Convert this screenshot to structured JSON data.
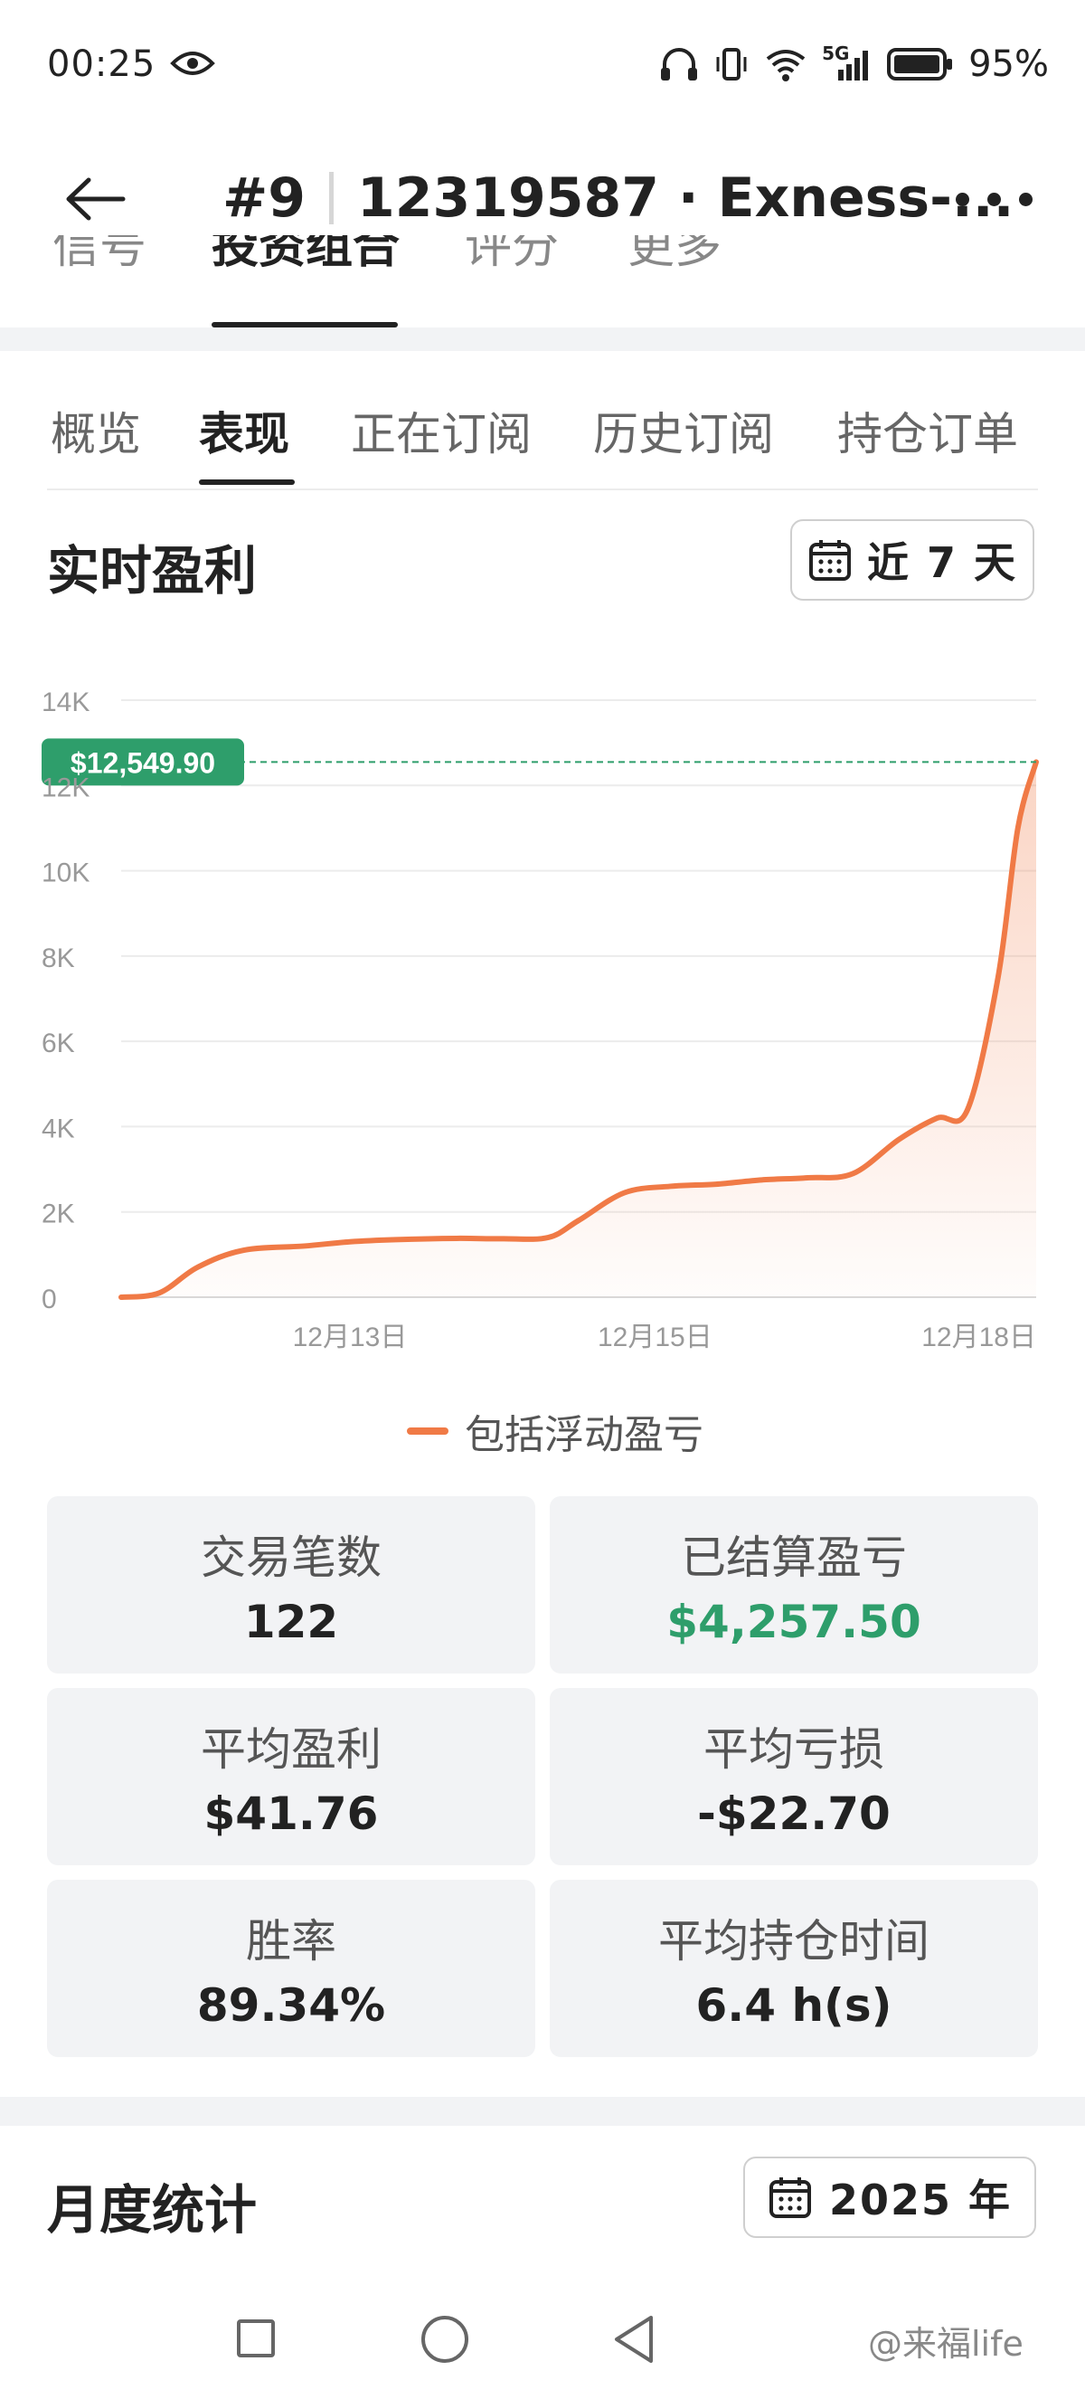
{
  "status_bar": {
    "time": "00:25",
    "network": "5G",
    "battery": "95%"
  },
  "header": {
    "rank": "#9",
    "account": "12319587 · Exness-...",
    "back_icon": "arrow-left-icon",
    "more_icon": "more-dots-icon"
  },
  "upper_tabs": [
    "信号",
    "投资组合",
    "评分",
    "更多"
  ],
  "tabs": [
    "概览",
    "表现",
    "正在订阅",
    "历史订阅",
    "持仓订单"
  ],
  "active_tab": "表现",
  "realtime": {
    "title": "实时盈利",
    "range_label": "近 7 天",
    "range_icon": "calendar-icon"
  },
  "chart_data": {
    "type": "area",
    "title": "",
    "xlabel": "",
    "ylabel": "",
    "ylim": [
      0,
      14000
    ],
    "yticks": [
      0,
      2000,
      4000,
      6000,
      8000,
      10000,
      12000,
      14000
    ],
    "ytick_labels": [
      "0",
      "2K",
      "4K",
      "6K",
      "8K",
      "10K",
      "12K",
      "14K"
    ],
    "xtick_labels": [
      "12月13日",
      "12月15日",
      "12月18日"
    ],
    "xticks": [
      1.5,
      3.5,
      6.0
    ],
    "xlim": [
      0,
      6.0
    ],
    "grid": true,
    "legend_position": "bottom",
    "current_value_label": "$12,549.90",
    "current_value": 12549.9,
    "colors": {
      "line": "#f07a46",
      "fill_top": "#fbd9c8",
      "marker_line": "#2e9e6b",
      "badge": "#2e9e6b",
      "grid": "#ececec",
      "axis_text": "#999999"
    },
    "series": [
      {
        "name": "包括浮动盈亏",
        "points": [
          [
            0,
            0
          ],
          [
            0.25,
            100
          ],
          [
            0.5,
            700
          ],
          [
            0.8,
            1100
          ],
          [
            1.2,
            1200
          ],
          [
            1.5,
            1300
          ],
          [
            1.8,
            1350
          ],
          [
            2.2,
            1380
          ],
          [
            2.5,
            1370
          ],
          [
            2.8,
            1400
          ],
          [
            3.0,
            1800
          ],
          [
            3.3,
            2450
          ],
          [
            3.6,
            2600
          ],
          [
            3.9,
            2650
          ],
          [
            4.2,
            2750
          ],
          [
            4.5,
            2800
          ],
          [
            4.8,
            2900
          ],
          [
            5.1,
            3700
          ],
          [
            5.35,
            4200
          ],
          [
            5.55,
            4400
          ],
          [
            5.75,
            7500
          ],
          [
            5.88,
            11000
          ],
          [
            6.0,
            12549.9
          ]
        ]
      }
    ]
  },
  "stats": [
    {
      "label": "交易笔数",
      "value": "122",
      "color": "#222222"
    },
    {
      "label": "已结算盈亏",
      "value": "$4,257.50",
      "color": "#2e9e6b"
    },
    {
      "label": "平均盈利",
      "value": "$41.76",
      "color": "#222222"
    },
    {
      "label": "平均亏损",
      "value": "-$22.70",
      "color": "#222222"
    },
    {
      "label": "胜率",
      "value": "89.34%",
      "color": "#222222"
    },
    {
      "label": "平均持仓时间",
      "value": "6.4 h(s)",
      "color": "#222222"
    }
  ],
  "monthly": {
    "title": "月度统计",
    "year_label": "2025 年",
    "year_icon": "calendar-icon"
  },
  "nav": {
    "recents_icon": "square-icon",
    "home_icon": "circle-icon",
    "back_icon": "triangle-back-icon"
  },
  "watermark": "@来福life"
}
